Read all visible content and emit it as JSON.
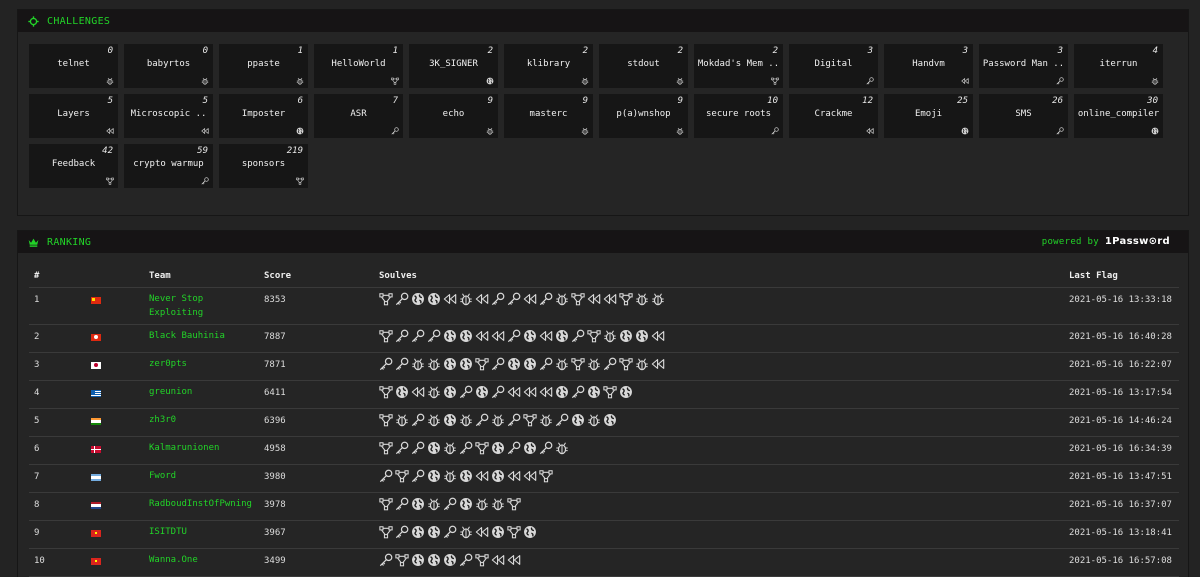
{
  "challenges": {
    "title": "CHALLENGES",
    "items": [
      {
        "name": "telnet",
        "points": "0",
        "icon": "bug-icon"
      },
      {
        "name": "babyrtos",
        "points": "0",
        "icon": "bug-icon"
      },
      {
        "name": "ppaste",
        "points": "1",
        "icon": "bug-icon"
      },
      {
        "name": "HelloWorld",
        "points": "1",
        "icon": "network-icon"
      },
      {
        "name": "3K_SIGNER",
        "points": "2",
        "icon": "globe-icon"
      },
      {
        "name": "klibrary",
        "points": "2",
        "icon": "bug-icon"
      },
      {
        "name": "stdout",
        "points": "2",
        "icon": "bug-icon"
      },
      {
        "name": "Mokdad's Mem ..",
        "points": "2",
        "icon": "network-icon"
      },
      {
        "name": "Digital",
        "points": "3",
        "icon": "key-icon"
      },
      {
        "name": "Handvm",
        "points": "3",
        "icon": "rewind-icon"
      },
      {
        "name": "Password Man ..",
        "points": "3",
        "icon": "key-icon"
      },
      {
        "name": "iterrun",
        "points": "4",
        "icon": "bug-icon"
      },
      {
        "name": "Layers",
        "points": "5",
        "icon": "rewind-icon"
      },
      {
        "name": "Microscopic ..",
        "points": "5",
        "icon": "rewind-icon"
      },
      {
        "name": "Imposter",
        "points": "6",
        "icon": "globe-icon"
      },
      {
        "name": "ASR",
        "points": "7",
        "icon": "key-icon"
      },
      {
        "name": "echo",
        "points": "9",
        "icon": "bug-icon"
      },
      {
        "name": "masterc",
        "points": "9",
        "icon": "bug-icon"
      },
      {
        "name": "p(a)wnshop",
        "points": "9",
        "icon": "bug-icon"
      },
      {
        "name": "secure roots",
        "points": "10",
        "icon": "key-icon"
      },
      {
        "name": "Crackme",
        "points": "12",
        "icon": "rewind-icon"
      },
      {
        "name": "Emoji",
        "points": "25",
        "icon": "globe-icon"
      },
      {
        "name": "SMS",
        "points": "26",
        "icon": "key-icon"
      },
      {
        "name": "online_compiler",
        "points": "30",
        "icon": "globe-icon"
      },
      {
        "name": "Feedback",
        "points": "42",
        "icon": "network-icon"
      },
      {
        "name": "crypto warmup",
        "points": "59",
        "icon": "key-icon"
      },
      {
        "name": "sponsors",
        "points": "219",
        "icon": "network-icon"
      }
    ]
  },
  "ranking": {
    "title": "RANKING",
    "powered_by": "powered by",
    "sponsor": "1Passw⊙rd",
    "headers": {
      "num": "#",
      "team": "Team",
      "score": "Score",
      "solves": "Soulves",
      "last_flag": "Last Flag"
    },
    "rows": [
      {
        "rank": "1",
        "flag": "cn",
        "team": "Never Stop Exploiting",
        "score": "8353",
        "last_flag": "2021-05-16 13:33:18",
        "solves": [
          "n",
          "k",
          "g",
          "g",
          "r",
          "b",
          "r",
          "k",
          "k",
          "r",
          "k",
          "b",
          "n",
          "r",
          "r",
          "n",
          "b",
          "b"
        ]
      },
      {
        "rank": "2",
        "flag": "hk",
        "team": "Black Bauhinia",
        "score": "7887",
        "last_flag": "2021-05-16 16:40:28",
        "solves": [
          "n",
          "k",
          "k",
          "k",
          "g",
          "g",
          "r",
          "r",
          "k",
          "g",
          "r",
          "g",
          "k",
          "n",
          "b",
          "g",
          "g",
          "r"
        ]
      },
      {
        "rank": "3",
        "flag": "jp",
        "team": "zer0pts",
        "score": "7871",
        "last_flag": "2021-05-16 16:22:07",
        "solves": [
          "k",
          "k",
          "b",
          "b",
          "g",
          "g",
          "n",
          "k",
          "g",
          "g",
          "k",
          "b",
          "n",
          "b",
          "k",
          "n",
          "b",
          "r"
        ]
      },
      {
        "rank": "4",
        "flag": "gr",
        "team": "greunion",
        "score": "6411",
        "last_flag": "2021-05-16 13:17:54",
        "solves": [
          "n",
          "g",
          "r",
          "b",
          "g",
          "k",
          "g",
          "k",
          "r",
          "r",
          "r",
          "g",
          "k",
          "g",
          "n",
          "g"
        ]
      },
      {
        "rank": "5",
        "flag": "in",
        "team": "zh3r0",
        "score": "6396",
        "last_flag": "2021-05-16 14:46:24",
        "solves": [
          "n",
          "b",
          "k",
          "b",
          "g",
          "b",
          "k",
          "b",
          "k",
          "n",
          "b",
          "k",
          "g",
          "b",
          "g"
        ]
      },
      {
        "rank": "6",
        "flag": "dk",
        "team": "Kalmarunionen",
        "score": "4958",
        "last_flag": "2021-05-16 16:34:39",
        "solves": [
          "n",
          "k",
          "k",
          "g",
          "b",
          "k",
          "n",
          "g",
          "k",
          "g",
          "k",
          "b"
        ]
      },
      {
        "rank": "7",
        "flag": "ar",
        "team": "Fword",
        "score": "3980",
        "last_flag": "2021-05-16 13:47:51",
        "solves": [
          "k",
          "n",
          "k",
          "g",
          "b",
          "g",
          "r",
          "g",
          "r",
          "r",
          "n"
        ]
      },
      {
        "rank": "8",
        "flag": "nl",
        "team": "RadboudInstOfPwning",
        "score": "3978",
        "last_flag": "2021-05-16 16:37:07",
        "solves": [
          "n",
          "k",
          "g",
          "b",
          "k",
          "g",
          "b",
          "b",
          "n"
        ]
      },
      {
        "rank": "9",
        "flag": "vn",
        "team": "ISITDTU",
        "score": "3967",
        "last_flag": "2021-05-16 13:18:41",
        "solves": [
          "n",
          "k",
          "g",
          "g",
          "k",
          "b",
          "r",
          "g",
          "n",
          "g"
        ]
      },
      {
        "rank": "10",
        "flag": "vn",
        "team": "Wanna.One",
        "score": "3499",
        "last_flag": "2021-05-16 16:57:08",
        "solves": [
          "k",
          "n",
          "g",
          "g",
          "g",
          "k",
          "n",
          "r",
          "r"
        ]
      }
    ]
  },
  "colors": {
    "accent_green": "#22d328",
    "card_bg": "#161616",
    "header_bg": "#161415",
    "page_bg": "#232323"
  }
}
